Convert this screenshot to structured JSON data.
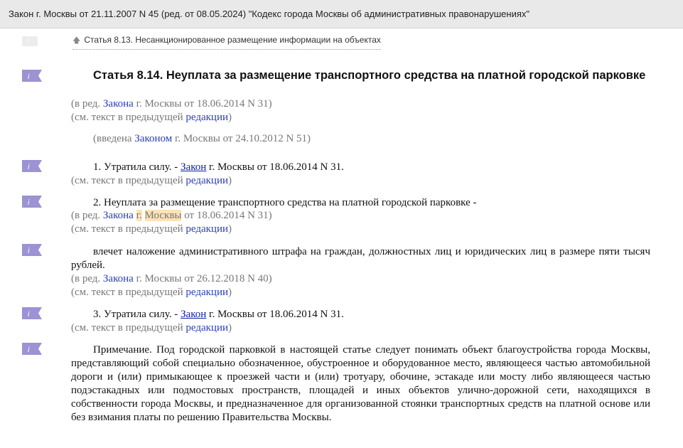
{
  "window": {
    "title": "Закон г. Москвы от 21.11.2007 N 45 (ред. от 08.05.2024) \"Кодекс города Москвы об административных правонарушениях\""
  },
  "nav": {
    "prev_link": "Статья 8.13. Несанкционированное размещение информации на объектах"
  },
  "icons": {
    "marker": "info-bookmark-icon",
    "arrow": "arrow-up-icon"
  },
  "colors": {
    "marker": "#9b93d3",
    "link": "#2b3fb5",
    "highlight": "#fbe3b8",
    "note": "#777777"
  },
  "article": {
    "heading": "Статья 8.14. Неуплата за размещение транспортного средства на платной городской парковке",
    "edit_note_prefix": "(в ред. ",
    "edit_note_link": "Закона",
    "edit_note_suffix": " г. Москвы от 18.06.2014 N 31)",
    "prev_text_prefix": "(см. текст в предыдущей ",
    "prev_text_link": "редакции",
    "prev_text_suffix": ")",
    "introduced_prefix": "(введена ",
    "introduced_link": "Законом",
    "introduced_suffix": " г. Москвы от 24.10.2012 N 51)"
  },
  "paragraphs": {
    "p1": {
      "text_prefix": "1. Утратила силу. - ",
      "link": "Закон",
      "text_suffix": " г. Москвы от 18.06.2014 N 31.",
      "prev_prefix": "(см. текст в предыдущей ",
      "prev_link": "редакции",
      "prev_suffix": ")"
    },
    "p2": {
      "text": "2. Неуплата за размещение транспортного средства на платной городской парковке -",
      "edit_prefix": "(в ред. ",
      "edit_link": "Закона",
      "edit_space": " ",
      "edit_hl1": "г.",
      "edit_hl_gap": " ",
      "edit_hl2": "Москвы",
      "edit_suffix": " от 18.06.2014 N 31)",
      "prev_prefix": "(см. текст в предыдущей ",
      "prev_link": "редакции",
      "prev_suffix": ")"
    },
    "p3": {
      "text": "влечет наложение административного штрафа на граждан, должностных лиц и юридических лиц в размере пяти тысяч рублей.",
      "edit_prefix": "(в ред. ",
      "edit_link": "Закона",
      "edit_suffix": " г. Москвы от 26.12.2018 N 40)",
      "prev_prefix": "(см. текст в предыдущей ",
      "prev_link": "редакции",
      "prev_suffix": ")"
    },
    "p4": {
      "text_prefix": "3. Утратила силу. - ",
      "link": "Закон",
      "text_suffix": " г. Москвы от 18.06.2014 N 31.",
      "prev_prefix": "(см. текст в предыдущей ",
      "prev_link": "редакции",
      "prev_suffix": ")"
    },
    "p5": {
      "text": "Примечание. Под городской парковкой в настоящей статье следует понимать объект благоустройства города Москвы, представляющий собой специально обозначенное, обустроенное и оборудованное место, являющееся частью автомобильной дороги и (или) примыкающее к проезжей части и (или) тротуару, обочине, эстакаде или мосту либо являющееся частью подэстакадных или подмостовых пространств, площадей и иных объектов улично-дорожной сети, находящихся в собственности города Москвы, и предназначенное для организованной стоянки транспортных средств на платной основе или без взимания платы по решению Правительства Москвы."
    }
  }
}
